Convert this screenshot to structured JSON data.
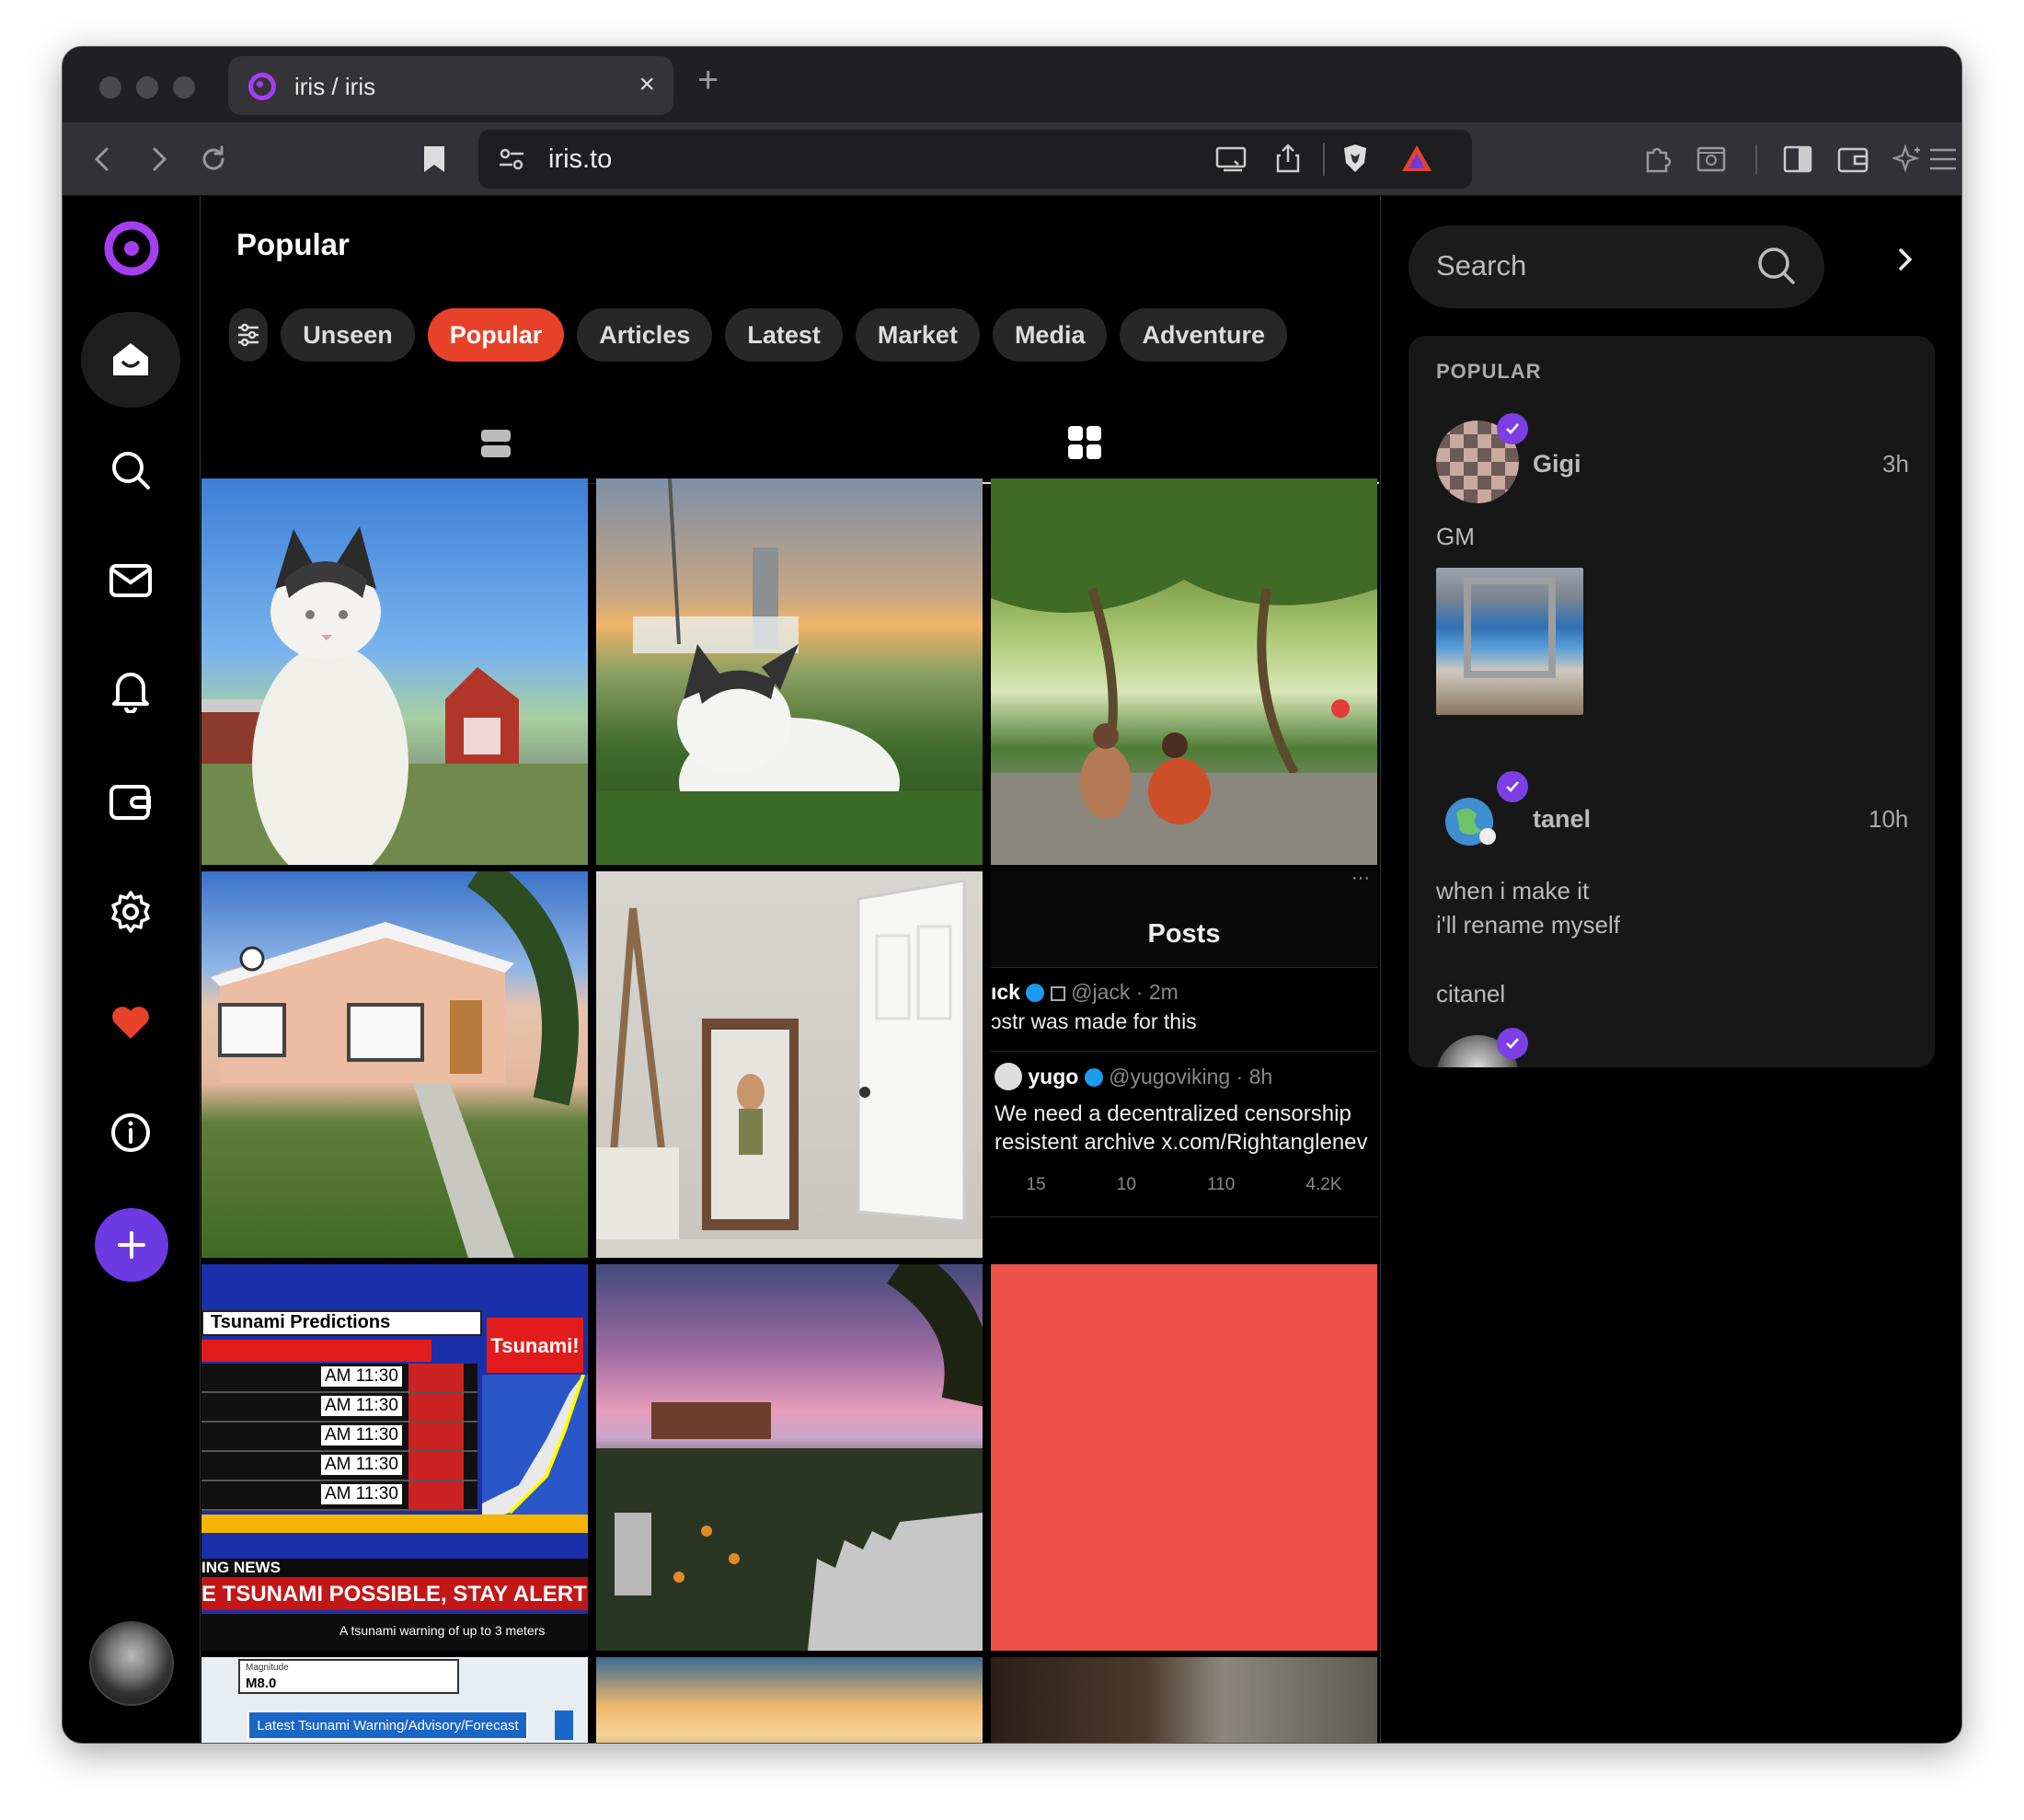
{
  "browser": {
    "tab_title": "iris / iris",
    "tab_close": "×",
    "new_tab": "+",
    "url": "iris.to"
  },
  "main": {
    "title": "Popular",
    "chips": [
      "Unseen",
      "Popular",
      "Articles",
      "Latest",
      "Market",
      "Media",
      "Adventure"
    ],
    "active_chip": "Popular"
  },
  "embedded_post": {
    "header": "Posts",
    "item1_author": "ıck",
    "item1_handle": "@jack · 2m",
    "item1_text": "ɔstr was made for this",
    "item2_author": "yugo",
    "item2_handle": "@yugoviking · 8h",
    "item2_line1": "We need a decentralized censorship",
    "item2_line2": "resistent archive x.com/Rightanglenev",
    "stats": [
      "15",
      "10",
      "110",
      "4.2K"
    ]
  },
  "tsunami_image": {
    "title": "Tsunami Predictions",
    "badge": "Tsunami!",
    "times": [
      "AM 11:30",
      "AM 11:30",
      "AM 11:30",
      "AM 11:30",
      "AM 11:30"
    ],
    "banner_small": "ING NEWS",
    "banner": "E TSUNAMI POSSIBLE, STAY ALERT",
    "ticker": "A tsunami warning of up to 3 meters",
    "magnitude_label": "Magnitude",
    "magnitude": "M8.0",
    "forecast": "Latest Tsunami Warning/Advisory/Forecast"
  },
  "sidebar": {
    "search_placeholder": "Search",
    "panel_title": "POPULAR",
    "posts": [
      {
        "author": "Gigi",
        "time": "3h",
        "text": "GM"
      },
      {
        "author": "tanel",
        "time": "10h",
        "line1": "when i make it",
        "line2": "i'll rename myself",
        "line3": "citanel"
      }
    ]
  },
  "colors": {
    "accent": "#e8422b",
    "brand": "#6c3ae0",
    "verified": "#7b3fe4"
  }
}
